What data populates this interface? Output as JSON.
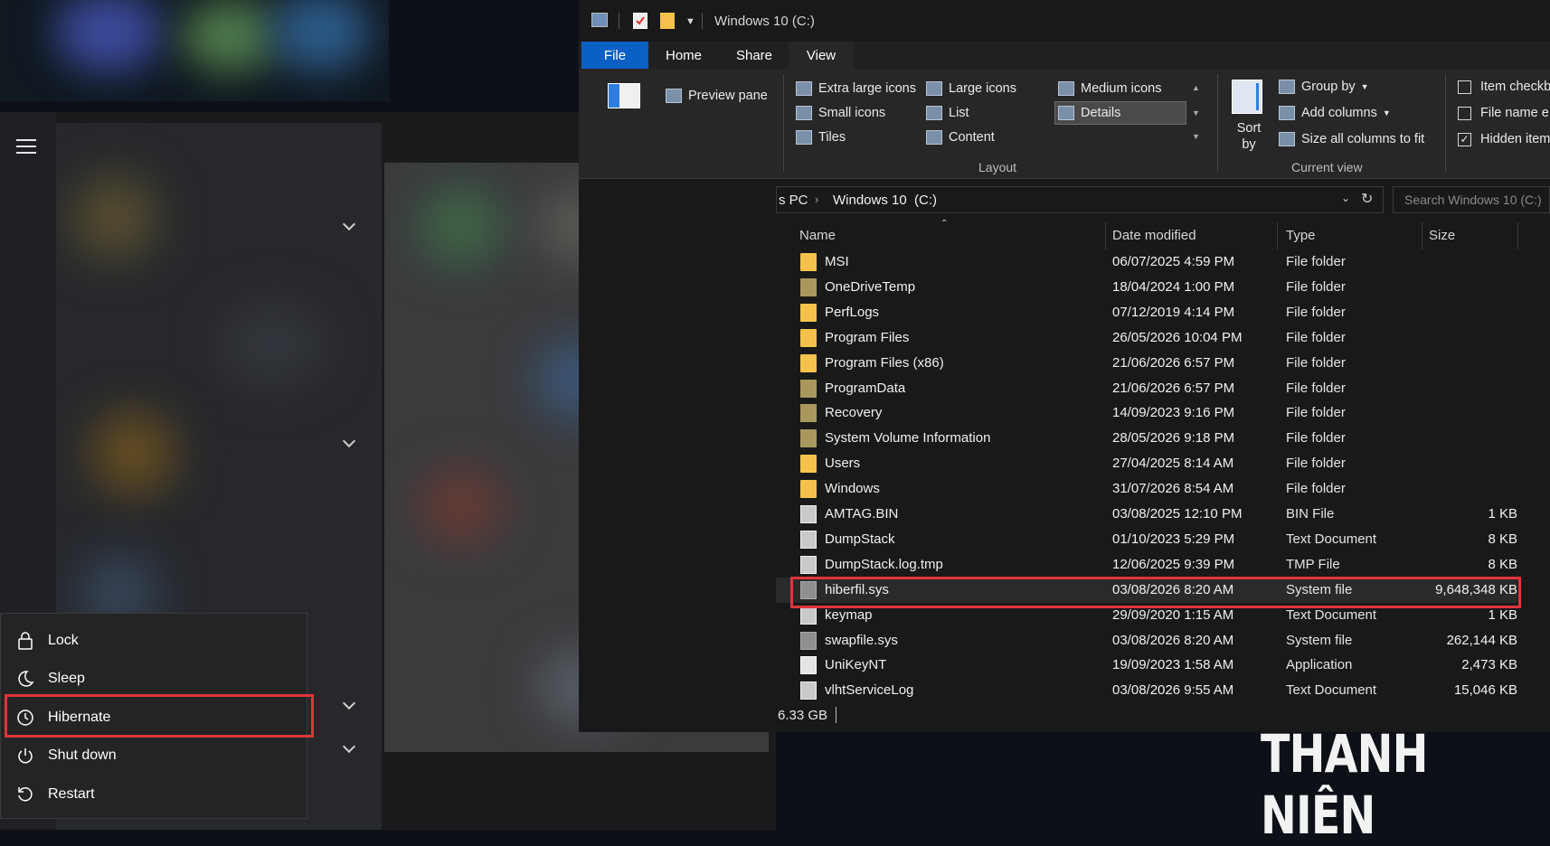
{
  "explorer": {
    "window_title": "Windows 10 (C:)",
    "tabs": [
      {
        "label": "File",
        "active": true
      },
      {
        "label": "Home"
      },
      {
        "label": "Share"
      },
      {
        "label": "View",
        "selected": true
      }
    ],
    "ribbon": {
      "preview_pane": "Preview pane",
      "layout": {
        "items": [
          "Extra large icons",
          "Large icons",
          "Medium icons",
          "Small icons",
          "List",
          "Details",
          "Tiles",
          "Content"
        ],
        "selected": "Details",
        "group_label": "Layout"
      },
      "current_view": {
        "sort_by": "Sort by",
        "group_by": "Group by",
        "add_columns": "Add columns",
        "size_columns": "Size all columns to fit",
        "group_label": "Current view"
      },
      "show_hide": {
        "item_checkboxes": "Item checkb",
        "file_name_ext": "File name e",
        "hidden_items": "Hidden item"
      }
    },
    "address": {
      "crumb_prev": "s PC",
      "crumb_current": "Windows 10  (C:)"
    },
    "search_placeholder": "Search Windows 10 (C:)",
    "columns": {
      "name": "Name",
      "date": "Date modified",
      "type": "Type",
      "size": "Size"
    },
    "files": [
      {
        "name": "MSI",
        "date": "06/07/2025 4:59 PM",
        "type": "File folder",
        "size": "",
        "icon": "folder-icon"
      },
      {
        "name": "OneDriveTemp",
        "date": "18/04/2024 1:00 PM",
        "type": "File folder",
        "size": "",
        "icon": "folder-dim-icon"
      },
      {
        "name": "PerfLogs",
        "date": "07/12/2019 4:14 PM",
        "type": "File folder",
        "size": "",
        "icon": "folder-icon"
      },
      {
        "name": "Program Files",
        "date": "26/05/2026 10:04 PM",
        "type": "File folder",
        "size": "",
        "icon": "folder-icon"
      },
      {
        "name": "Program Files (x86)",
        "date": "21/06/2026 6:57 PM",
        "type": "File folder",
        "size": "",
        "icon": "folder-icon"
      },
      {
        "name": "ProgramData",
        "date": "21/06/2026 6:57 PM",
        "type": "File folder",
        "size": "",
        "icon": "folder-dim-icon"
      },
      {
        "name": "Recovery",
        "date": "14/09/2023 9:16 PM",
        "type": "File folder",
        "size": "",
        "icon": "folder-dim-icon"
      },
      {
        "name": "System Volume Information",
        "date": "28/05/2026 9:18 PM",
        "type": "File folder",
        "size": "",
        "icon": "folder-dim-icon"
      },
      {
        "name": "Users",
        "date": "27/04/2025 8:14 AM",
        "type": "File folder",
        "size": "",
        "icon": "folder-icon"
      },
      {
        "name": "Windows",
        "date": "31/07/2026 8:54 AM",
        "type": "File folder",
        "size": "",
        "icon": "folder-icon"
      },
      {
        "name": "AMTAG.BIN",
        "date": "03/08/2025 12:10 PM",
        "type": "BIN File",
        "size": "1 KB",
        "icon": "file-icon"
      },
      {
        "name": "DumpStack",
        "date": "01/10/2023 5:29 PM",
        "type": "Text Document",
        "size": "8 KB",
        "icon": "file-icon"
      },
      {
        "name": "DumpStack.log.tmp",
        "date": "12/06/2025 9:39 PM",
        "type": "TMP File",
        "size": "8 KB",
        "icon": "file-icon"
      },
      {
        "name": "hiberfil.sys",
        "date": "03/08/2026 8:20 AM",
        "type": "System file",
        "size": "9,648,348 KB",
        "icon": "system-file-icon",
        "highlighted": true
      },
      {
        "name": "keymap",
        "date": "29/09/2020 1:15 AM",
        "type": "Text Document",
        "size": "1 KB",
        "icon": "file-icon"
      },
      {
        "name": "swapfile.sys",
        "date": "03/08/2026 8:20 AM",
        "type": "System file",
        "size": "262,144 KB",
        "icon": "system-file-icon"
      },
      {
        "name": "UniKeyNT",
        "date": "19/09/2023 1:58 AM",
        "type": "Application",
        "size": "2,473 KB",
        "icon": "application-icon"
      },
      {
        "name": "vlhtServiceLog",
        "date": "03/08/2026 9:55 AM",
        "type": "Text Document",
        "size": "15,046 KB",
        "icon": "file-icon"
      }
    ],
    "status_text": "6.33 GB"
  },
  "power_menu": {
    "items": [
      {
        "label": "Lock",
        "icon": "lock-icon"
      },
      {
        "label": "Sleep",
        "icon": "moon-icon"
      },
      {
        "label": "Hibernate",
        "icon": "clock-icon",
        "highlighted": true
      },
      {
        "label": "Shut down",
        "icon": "power-icon"
      },
      {
        "label": "Restart",
        "icon": "restart-icon"
      }
    ]
  },
  "watermark": "THANH NIÊN",
  "colors": {
    "highlight": "#e0353b",
    "file_tab": "#0a60c4",
    "folder": "#f5c24c"
  }
}
